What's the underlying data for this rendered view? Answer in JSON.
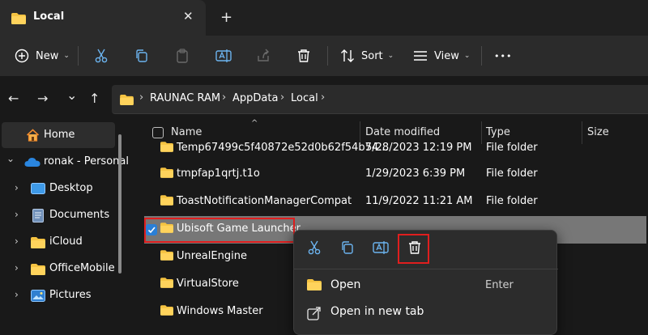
{
  "tab": {
    "title": "Local",
    "close": "✕",
    "add": "+"
  },
  "toolbar": {
    "new_label": "New",
    "sort_label": "Sort",
    "view_label": "View",
    "more": "•••"
  },
  "nav": {
    "back": "←",
    "forward": "→",
    "recent": "⌄",
    "up": "↑"
  },
  "address": {
    "sep": "›",
    "crumbs": [
      "RAUNAC RAM",
      "AppData",
      "Local"
    ]
  },
  "sidebar": {
    "items": [
      {
        "label": "Home",
        "icon": "home-icon"
      },
      {
        "label": "ronak - Personal",
        "icon": "cloud-icon"
      },
      {
        "label": "Desktop",
        "icon": "desktop-icon"
      },
      {
        "label": "Documents",
        "icon": "documents-icon"
      },
      {
        "label": "iCloud",
        "icon": "folder-icon"
      },
      {
        "label": "OfficeMobile",
        "icon": "folder-icon"
      },
      {
        "label": "Pictures",
        "icon": "pictures-icon"
      }
    ],
    "chevron_right": "›",
    "chevron_down": "⌄"
  },
  "columns": {
    "name": "Name",
    "date": "Date modified",
    "type": "Type",
    "size": "Size",
    "sort_indicator": "^"
  },
  "files": [
    {
      "name": "Temp67499c5f40872e52d0b62f54b74...",
      "date": "5/28/2023 12:19 PM",
      "type": "File folder"
    },
    {
      "name": "tmpfap1qrtj.t1o",
      "date": "1/29/2023 6:39 PM",
      "type": "File folder"
    },
    {
      "name": "ToastNotificationManagerCompat",
      "date": "11/9/2022 11:21 AM",
      "type": "File folder"
    },
    {
      "name": "Ubisoft Game Launcher",
      "date": "",
      "type": ""
    },
    {
      "name": "UnrealEngine",
      "date": "",
      "type": ""
    },
    {
      "name": "VirtualStore",
      "date": "",
      "type": ""
    },
    {
      "name": "Windows Master",
      "date": "",
      "type": ""
    }
  ],
  "context_menu": {
    "items": [
      {
        "label": "Open",
        "shortcut": "Enter",
        "icon": "folder-icon"
      },
      {
        "label": "Open in new tab",
        "shortcut": "",
        "icon": "open-new-tab-icon"
      }
    ]
  },
  "colors": {
    "accent": "#2a7fd6",
    "highlight": "#e01e1e",
    "folder": "#f5c342",
    "selected_row": "#777777"
  }
}
